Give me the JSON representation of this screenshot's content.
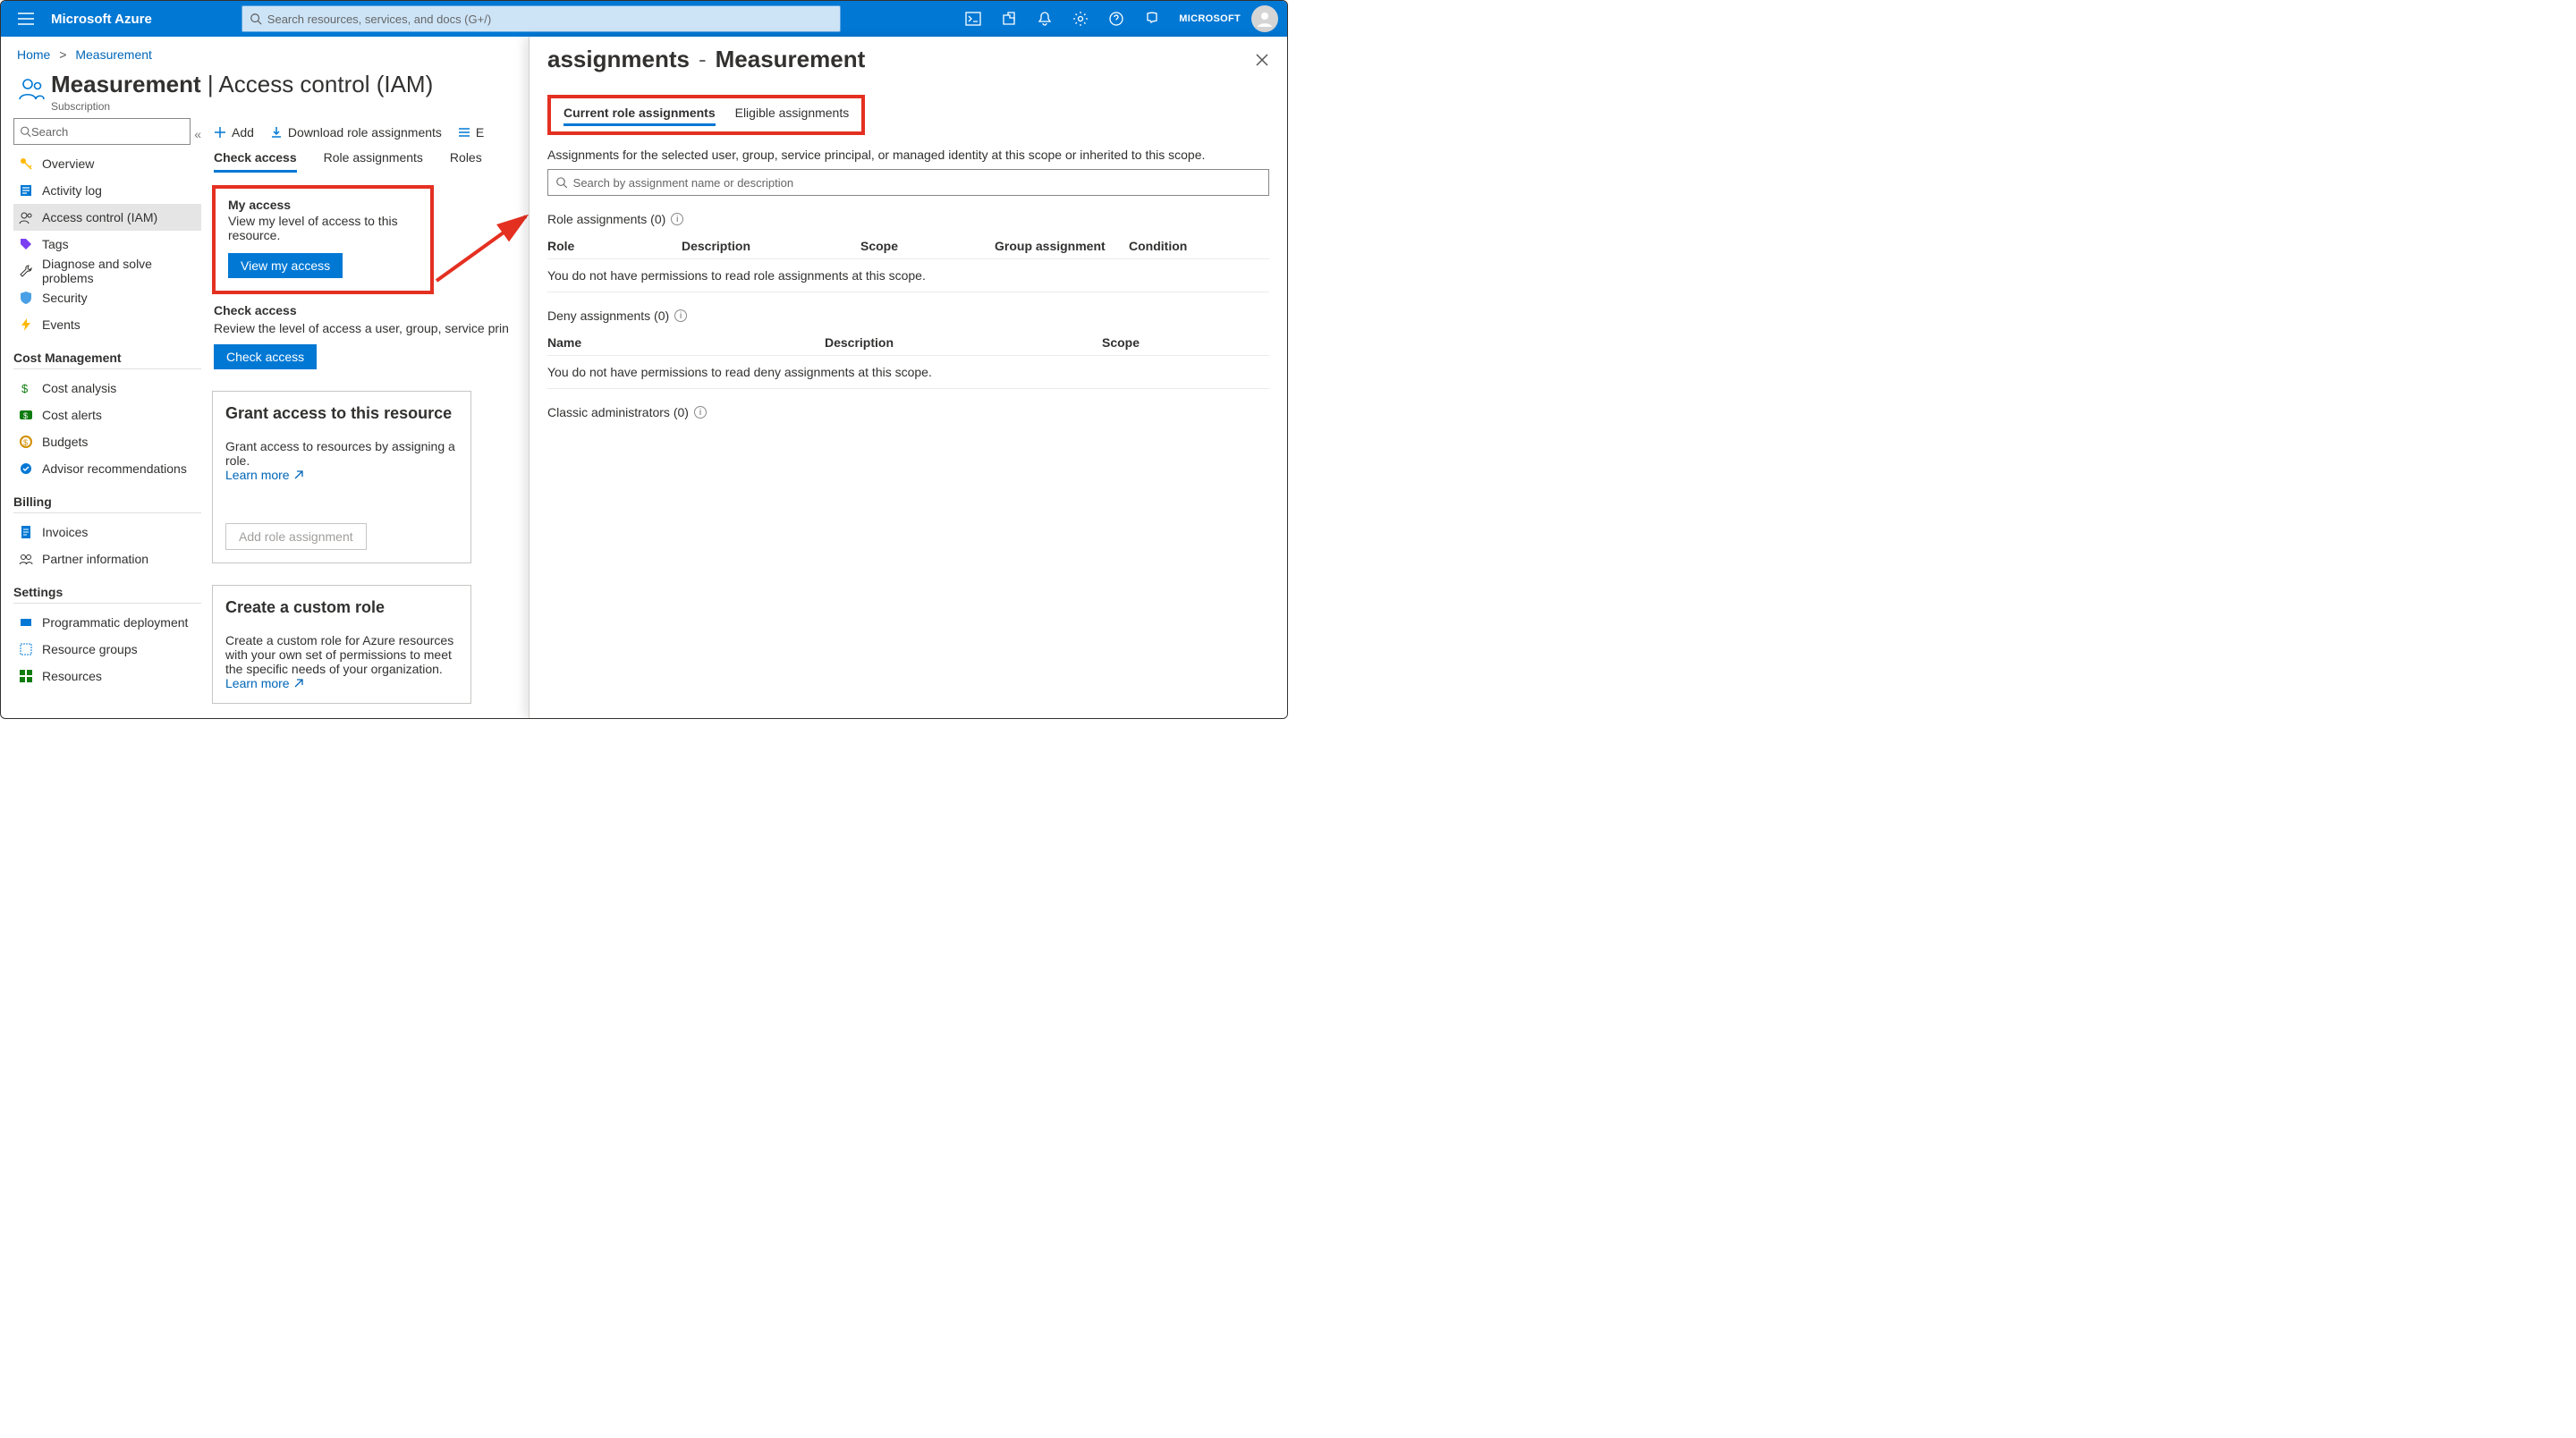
{
  "header": {
    "brand": "Microsoft Azure",
    "search_placeholder": "Search resources, services, and docs (G+/)",
    "tenant": "MICROSOFT"
  },
  "breadcrumb": {
    "home": "Home",
    "current": "Measurement"
  },
  "page": {
    "title_strong": "Measurement",
    "title_thin": "Access control (IAM)",
    "subtitle": "Subscription"
  },
  "leftnav": {
    "search_placeholder": "Search",
    "items_top": [
      {
        "label": "Overview",
        "icon": "key"
      },
      {
        "label": "Activity log",
        "icon": "log"
      },
      {
        "label": "Access control (IAM)",
        "icon": "people",
        "active": true
      },
      {
        "label": "Tags",
        "icon": "tag"
      },
      {
        "label": "Diagnose and solve problems",
        "icon": "wrench"
      },
      {
        "label": "Security",
        "icon": "shield"
      },
      {
        "label": "Events",
        "icon": "bolt"
      }
    ],
    "section_cost_title": "Cost Management",
    "items_cost": [
      {
        "label": "Cost analysis",
        "icon": "dollar"
      },
      {
        "label": "Cost alerts",
        "icon": "alert-dollar"
      },
      {
        "label": "Budgets",
        "icon": "budget"
      },
      {
        "label": "Advisor recommendations",
        "icon": "advisor"
      }
    ],
    "section_billing_title": "Billing",
    "items_billing": [
      {
        "label": "Invoices",
        "icon": "invoice"
      },
      {
        "label": "Partner information",
        "icon": "partner"
      }
    ],
    "section_settings_title": "Settings",
    "items_settings": [
      {
        "label": "Programmatic deployment",
        "icon": "deploy"
      },
      {
        "label": "Resource groups",
        "icon": "rg"
      },
      {
        "label": "Resources",
        "icon": "resources"
      }
    ]
  },
  "toolbar": {
    "add": "Add",
    "download": "Download role assignments",
    "edit_cols": "E"
  },
  "tabs": {
    "check_access": "Check access",
    "role_assignments": "Role assignments",
    "roles": "Roles"
  },
  "my_access": {
    "heading": "My access",
    "text": "View my level of access to this resource.",
    "button": "View my access"
  },
  "check_access": {
    "heading": "Check access",
    "text": "Review the level of access a user, group, service prin",
    "button": "Check access"
  },
  "grant_card": {
    "heading": "Grant access to this resource",
    "text": "Grant access to resources by assigning a role.",
    "learn_more": "Learn more",
    "button": "Add role assignment"
  },
  "custom_role_card": {
    "heading": "Create a custom role",
    "text": "Create a custom role for Azure resources with your own set of permissions to meet the specific needs of your organization.",
    "learn_more": "Learn more"
  },
  "rpanel": {
    "title_left": "assignments",
    "title_right": "Measurement",
    "tab_current": "Current role assignments",
    "tab_eligible": "Eligible assignments",
    "help": "Assignments for the selected user, group, service principal, or managed identity at this scope or inherited to this scope.",
    "search_placeholder": "Search by assignment name or description",
    "role_assignments_h": "Role assignments (0)",
    "role_cols": {
      "role": "Role",
      "desc": "Description",
      "scope": "Scope",
      "group": "Group assignment",
      "cond": "Condition"
    },
    "role_empty": "You do not have permissions to read role assignments at this scope.",
    "deny_h": "Deny assignments (0)",
    "deny_cols": {
      "name": "Name",
      "desc": "Description",
      "scope": "Scope"
    },
    "deny_empty": "You do not have permissions to read deny assignments at this scope.",
    "classic_h": "Classic administrators (0)"
  }
}
